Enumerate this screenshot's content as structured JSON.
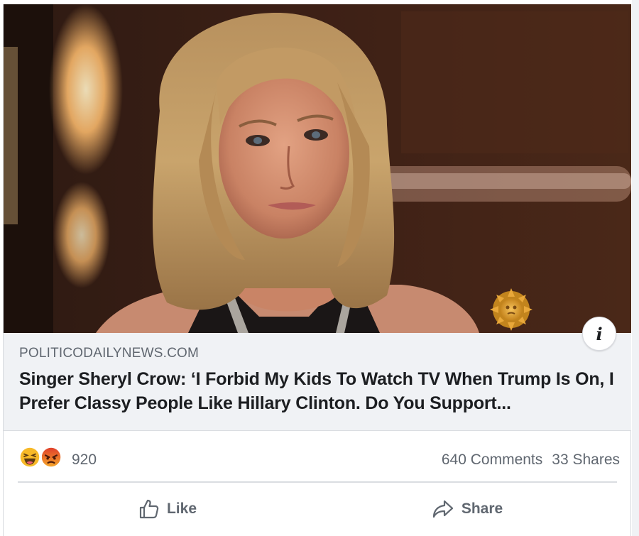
{
  "post": {
    "link": {
      "domain": "POLITICODAILYNEWS.COM",
      "title": "Singer Sheryl Crow: ‘I Forbid My Kids To Watch TV When Trump Is On, I Prefer Classy People Like Hillary Clinton. Do You Support...",
      "image_icon": "photo-of-woman",
      "info_icon": "info-icon",
      "info_label": "i"
    },
    "reactions": {
      "types": [
        "haha-reaction-icon",
        "angry-reaction-icon"
      ],
      "count": "920"
    },
    "stats": {
      "comments": "640 Comments",
      "shares": "33 Shares"
    },
    "actions": {
      "like_label": "Like",
      "like_icon": "thumbs-up-icon",
      "share_label": "Share",
      "share_icon": "share-arrow-icon"
    }
  },
  "colors": {
    "link_background": "#f0f2f5",
    "secondary_text": "#606770",
    "primary_text": "#1c1e21",
    "divider": "#dadde1",
    "haha_yellow": "#f7b928",
    "angry_red": "#e9710f"
  }
}
